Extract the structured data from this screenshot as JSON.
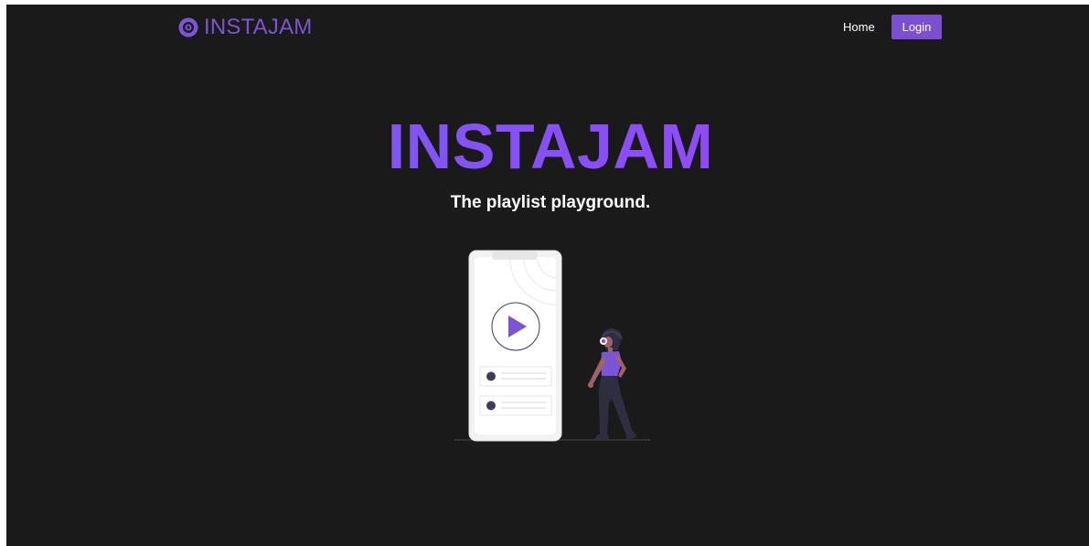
{
  "navbar": {
    "brand_name": "INSTAJAM",
    "brand_icon": "vinyl-disc-icon",
    "home_label": "Home",
    "login_label": "Login"
  },
  "hero": {
    "title": "INSTAJAM",
    "subtitle": "The playlist playground."
  },
  "illustration": {
    "description_icon": "phone-music-listener-illustration",
    "play_icon": "play-icon"
  },
  "colors": {
    "background": "#1b1a1b",
    "accent": "#7b4fcf",
    "title_gradient_start": "#6f63f0",
    "title_gradient_end": "#a246f7"
  }
}
